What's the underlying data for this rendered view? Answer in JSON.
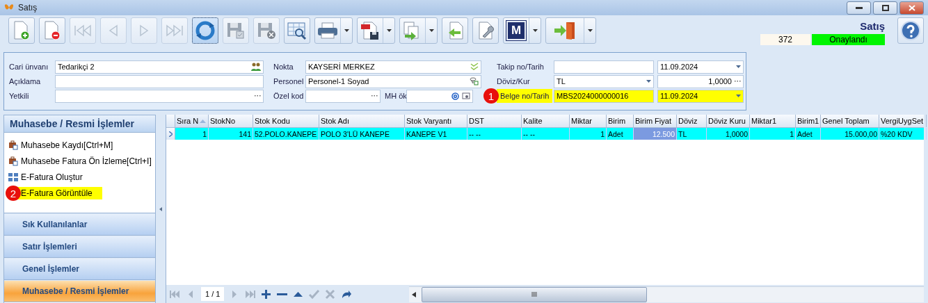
{
  "window": {
    "title": "Satış"
  },
  "toolbar": {
    "buttons": [
      {
        "kind": "new",
        "disabled": false,
        "focused": false,
        "dropdown": false
      },
      {
        "kind": "delete",
        "disabled": false,
        "focused": false,
        "dropdown": false
      },
      {
        "kind": "first",
        "disabled": true,
        "focused": false,
        "dropdown": false
      },
      {
        "kind": "prev",
        "disabled": true,
        "focused": false,
        "dropdown": false
      },
      {
        "kind": "next",
        "disabled": true,
        "focused": false,
        "dropdown": false
      },
      {
        "kind": "last",
        "disabled": true,
        "focused": false,
        "dropdown": false
      },
      {
        "kind": "refresh",
        "disabled": false,
        "focused": true,
        "dropdown": false
      },
      {
        "kind": "save",
        "disabled": true,
        "focused": false,
        "dropdown": false
      },
      {
        "kind": "save-cancel",
        "disabled": true,
        "focused": false,
        "dropdown": false
      },
      {
        "kind": "grid-search",
        "disabled": false,
        "focused": false,
        "dropdown": false
      },
      {
        "kind": "print",
        "disabled": false,
        "focused": false,
        "dropdown": true
      },
      {
        "kind": "pdf",
        "disabled": false,
        "focused": false,
        "dropdown": true
      },
      {
        "kind": "export",
        "disabled": false,
        "focused": false,
        "dropdown": true
      },
      {
        "kind": "import",
        "disabled": false,
        "focused": false,
        "dropdown": false
      },
      {
        "kind": "tools",
        "disabled": false,
        "focused": false,
        "dropdown": false
      },
      {
        "kind": "letter",
        "label": "M",
        "disabled": false,
        "focused": false,
        "dropdown": true
      },
      {
        "kind": "exit",
        "disabled": false,
        "focused": false,
        "dropdown": true
      }
    ]
  },
  "document": {
    "title": "Satış",
    "number": "372",
    "status": "Onaylandı"
  },
  "form": {
    "column_1": [
      {
        "label": "Cari ünvanı",
        "value": "Tedarikçi 2",
        "kind": "lookup"
      },
      {
        "label": "Açıklama",
        "kind": "text"
      },
      {
        "label": "Yetkili",
        "kind": "ellipsis"
      }
    ],
    "column_2": [
      {
        "label": "Nokta",
        "value": "KAYSERİ MERKEZ",
        "kind": "check"
      },
      {
        "label": "Personel",
        "value": "Personel-1 Soyad",
        "kind": "person"
      },
      {
        "label": "Özel kod",
        "kind": "ellipsis",
        "extra_label": "MH ök"
      }
    ],
    "column_3": [
      {
        "label": "Takip no/Tarih",
        "date": "11.09.2024",
        "highlighted": false,
        "kind": "text"
      },
      {
        "label": "Döviz/Kur",
        "value": "TL",
        "rate": "1,0000",
        "highlighted": false,
        "kind": "currency"
      },
      {
        "label": "Belge no/Tarih",
        "value": "MBS2024000000016",
        "date": "11.09.2024",
        "highlighted": true,
        "badge": "1",
        "kind": "text"
      }
    ]
  },
  "side_panel": {
    "title": "Muhasebe / Resmi İşlemler",
    "items": [
      {
        "label": "Muhasebe Kaydı[Ctrl+M]",
        "kind": "briefcase",
        "highlighted": false
      },
      {
        "label": "Muhasebe Fatura Ön İzleme[Ctrl+I]",
        "kind": "briefcase",
        "highlighted": false
      },
      {
        "label": "E-Fatura Oluştur",
        "kind": "grid",
        "highlighted": false
      },
      {
        "label": "E-Fatura Görüntüle",
        "kind": "none",
        "highlighted": true,
        "badge": "2"
      }
    ],
    "groups": [
      {
        "label": "Sık Kullanılanlar",
        "selected": false
      },
      {
        "label": "Satır İşlemleri",
        "selected": false
      },
      {
        "label": "Genel İşlemler",
        "selected": false
      },
      {
        "label": "Muhasebe / Resmi İşlemler",
        "selected": true
      }
    ]
  },
  "table": {
    "columns": [
      {
        "label": "Sıra N",
        "kind": "number",
        "sorted": true
      },
      {
        "label": "StokNo",
        "kind": "number",
        "sorted": false
      },
      {
        "label": "Stok Kodu",
        "kind": "text",
        "sorted": false
      },
      {
        "label": "Stok Adı",
        "kind": "text",
        "sorted": false
      },
      {
        "label": "Stok Varyantı",
        "kind": "text",
        "sorted": false
      },
      {
        "label": "DST",
        "kind": "text",
        "sorted": false
      },
      {
        "label": "Kalite",
        "kind": "text",
        "sorted": false
      },
      {
        "label": "Miktar",
        "kind": "number",
        "sorted": false
      },
      {
        "label": "Birim",
        "kind": "text",
        "sorted": false
      },
      {
        "label": "Birim Fiyat",
        "kind": "number",
        "sorted": false
      },
      {
        "label": "Döviz",
        "kind": "text",
        "sorted": false
      },
      {
        "label": "Döviz Kuru",
        "kind": "number",
        "sorted": false
      },
      {
        "label": "Miktar1",
        "kind": "number",
        "sorted": false
      },
      {
        "label": "Birim1",
        "kind": "text",
        "sorted": false
      },
      {
        "label": "Genel Toplam",
        "kind": "number",
        "sorted": false
      },
      {
        "label": "VergiUygSet",
        "kind": "text",
        "sorted": false
      }
    ],
    "rows": [
      {
        "selected": true,
        "cells": [
          {
            "text": "1",
            "focused": false
          },
          {
            "text": "141",
            "focused": false
          },
          {
            "text": "52.POLO.KANEPE",
            "focused": false
          },
          {
            "text": "POLO 3'LÜ KANEPE",
            "focused": false
          },
          {
            "text": "KANEPE V1",
            "focused": false
          },
          {
            "text": "-- --",
            "focused": false
          },
          {
            "text": "-- --",
            "focused": false
          },
          {
            "text": "1",
            "focused": false
          },
          {
            "text": "Adet",
            "focused": false
          },
          {
            "text": "12.500",
            "focused": true
          },
          {
            "text": "TL",
            "focused": false
          },
          {
            "text": "1,0000",
            "focused": false
          },
          {
            "text": "1",
            "focused": false
          },
          {
            "text": "Adet",
            "focused": false
          },
          {
            "text": "15.000,00",
            "focused": false
          },
          {
            "text": "%20 KDV",
            "focused": false
          }
        ]
      }
    ]
  },
  "navigator": {
    "position": "1 / 1",
    "buttons": [
      {
        "kind": "first",
        "disabled": true
      },
      {
        "kind": "prev",
        "disabled": true
      },
      {
        "kind": "next",
        "disabled": true
      },
      {
        "kind": "last",
        "disabled": true
      },
      {
        "kind": "add",
        "disabled": false
      },
      {
        "kind": "remove",
        "disabled": false
      },
      {
        "kind": "up",
        "disabled": false
      },
      {
        "kind": "confirm",
        "disabled": true
      },
      {
        "kind": "cancel",
        "disabled": true
      },
      {
        "kind": "redo",
        "disabled": false
      }
    ]
  }
}
